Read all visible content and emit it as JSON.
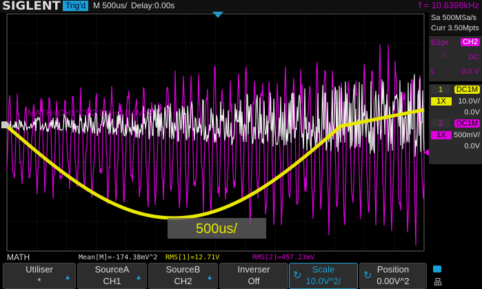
{
  "header": {
    "brand": "SIGLENT",
    "trigger_status": "Trig'd",
    "timebase": "M 500us/",
    "delay": "Delay:0.00s",
    "frequency": "f = 10.6398kHz"
  },
  "acquisition": {
    "sample_rate": "Sa 500MSa/s",
    "memory": "Curr 3.50Mpts"
  },
  "trigger": {
    "type": "Edge",
    "source": "CH2",
    "coupling": "DC",
    "level_label": "L",
    "level": "0.0 V"
  },
  "channels": [
    {
      "num": "1",
      "coupling": "DC1M",
      "probe": "1X",
      "scale": "10.0V/",
      "offset": "0.0V",
      "color": "#e8e800"
    },
    {
      "num": "2",
      "coupling": "DC1M",
      "probe": "1X",
      "scale": "500mV/",
      "offset": "0.0V",
      "color": "#e000e0"
    }
  ],
  "overlay": {
    "math_label": "MATH=CH1*CH2 DIV=10.0V^2",
    "timebase_popup": "500us/"
  },
  "measurements": {
    "menu_title": "MATH",
    "mean": "Mean[M]=-174.38mV^2",
    "rms1": "RMS[1]=12.71V",
    "rms2": "RMS[2]=457.23mV"
  },
  "menu": [
    {
      "label": "Utiliser",
      "value": "*"
    },
    {
      "label": "SourceA",
      "value": "CH1"
    },
    {
      "label": "SourceB",
      "value": "CH2"
    },
    {
      "label": "Inverser",
      "value": "Off"
    },
    {
      "label": "Scale",
      "value": "10.0V^2/"
    },
    {
      "label": "Position",
      "value": "0.00V^2"
    }
  ],
  "colors": {
    "accent": "#1aa0d8",
    "ch1": "#e8e800",
    "ch2": "#e000e0",
    "math": "#ffffff"
  }
}
